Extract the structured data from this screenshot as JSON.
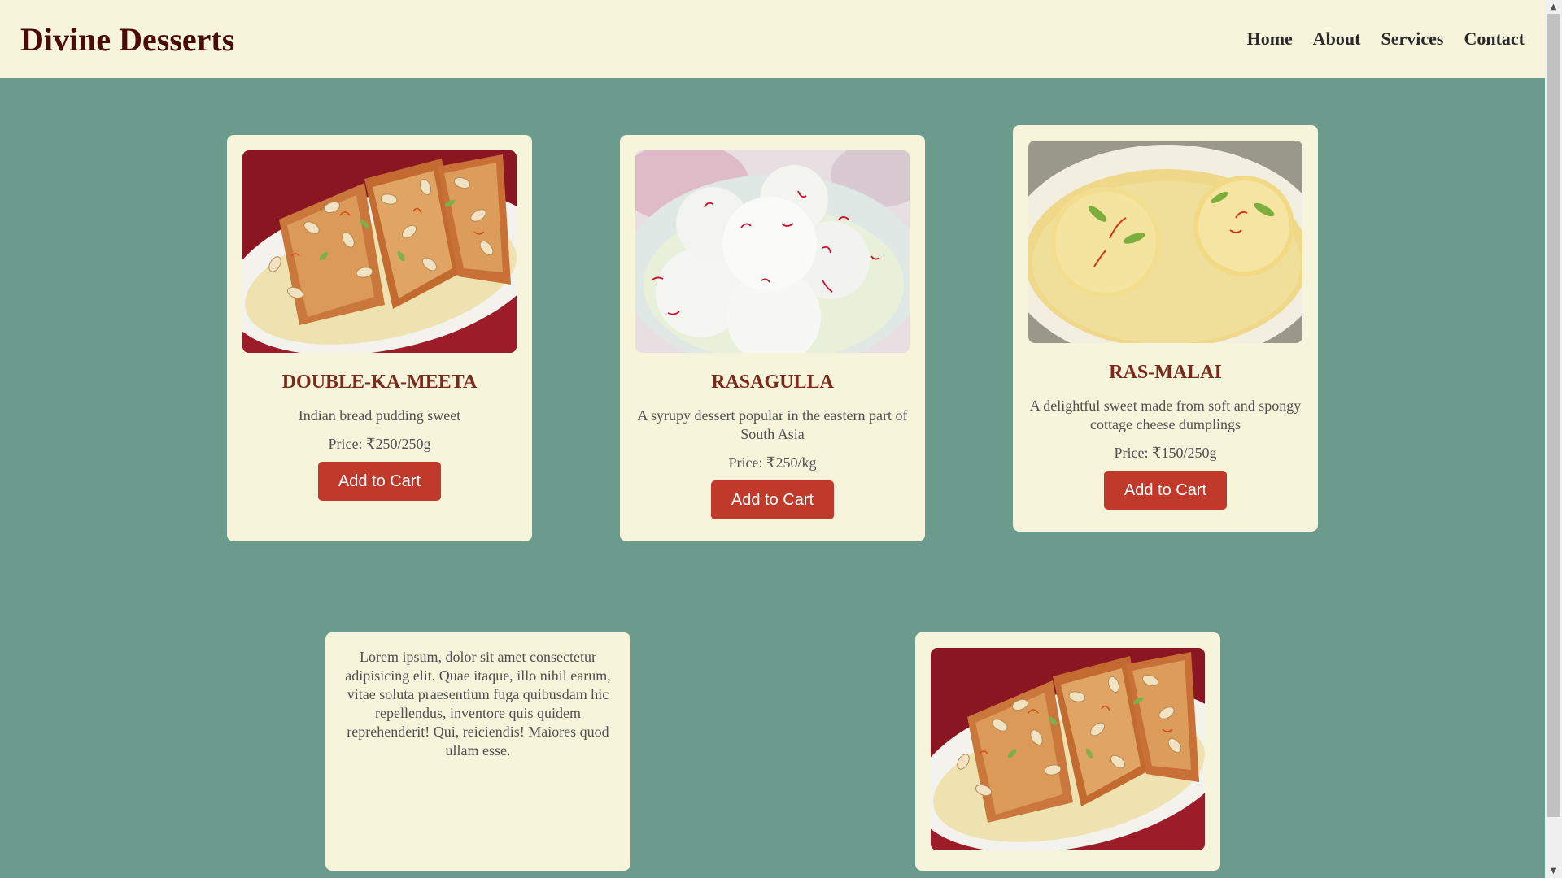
{
  "brand": "Divine Desserts",
  "nav": {
    "links": [
      "Home",
      "About",
      "Services",
      "Contact"
    ]
  },
  "products": [
    {
      "title": "DOUBLE-KA-MEETA",
      "desc": "Indian bread pudding sweet",
      "price": "Price: ₹250/250g",
      "button": "Add to Cart",
      "image_icon": "double-ka-meeta-photo"
    },
    {
      "title": "RASAGULLA",
      "desc": "A syrupy dessert popular in the eastern part of South Asia",
      "price": "Price: ₹250/kg",
      "button": "Add to Cart",
      "image_icon": "rasagulla-photo"
    },
    {
      "title": "RAS-MALAI",
      "desc": "A delightful sweet made from soft and spongy cottage cheese dumplings",
      "price": "Price: ₹150/250g",
      "button": "Add to Cart",
      "image_icon": "ras-malai-photo"
    }
  ],
  "lorem": {
    "text": "Lorem ipsum, dolor sit amet consectetur adipisicing elit. Quae itaque, illo nihil earum, vitae soluta praesentium fuga quibusdam hic repellendus, inventore quis quidem reprehenderit! Qui, reiciendis! Maiores quod ullam esse."
  },
  "colors": {
    "page_bg": "#6b9b8c",
    "card_bg": "#f6f4da",
    "brand": "#4a0a08",
    "title": "#7a2a1c",
    "button": "#c0392b"
  }
}
